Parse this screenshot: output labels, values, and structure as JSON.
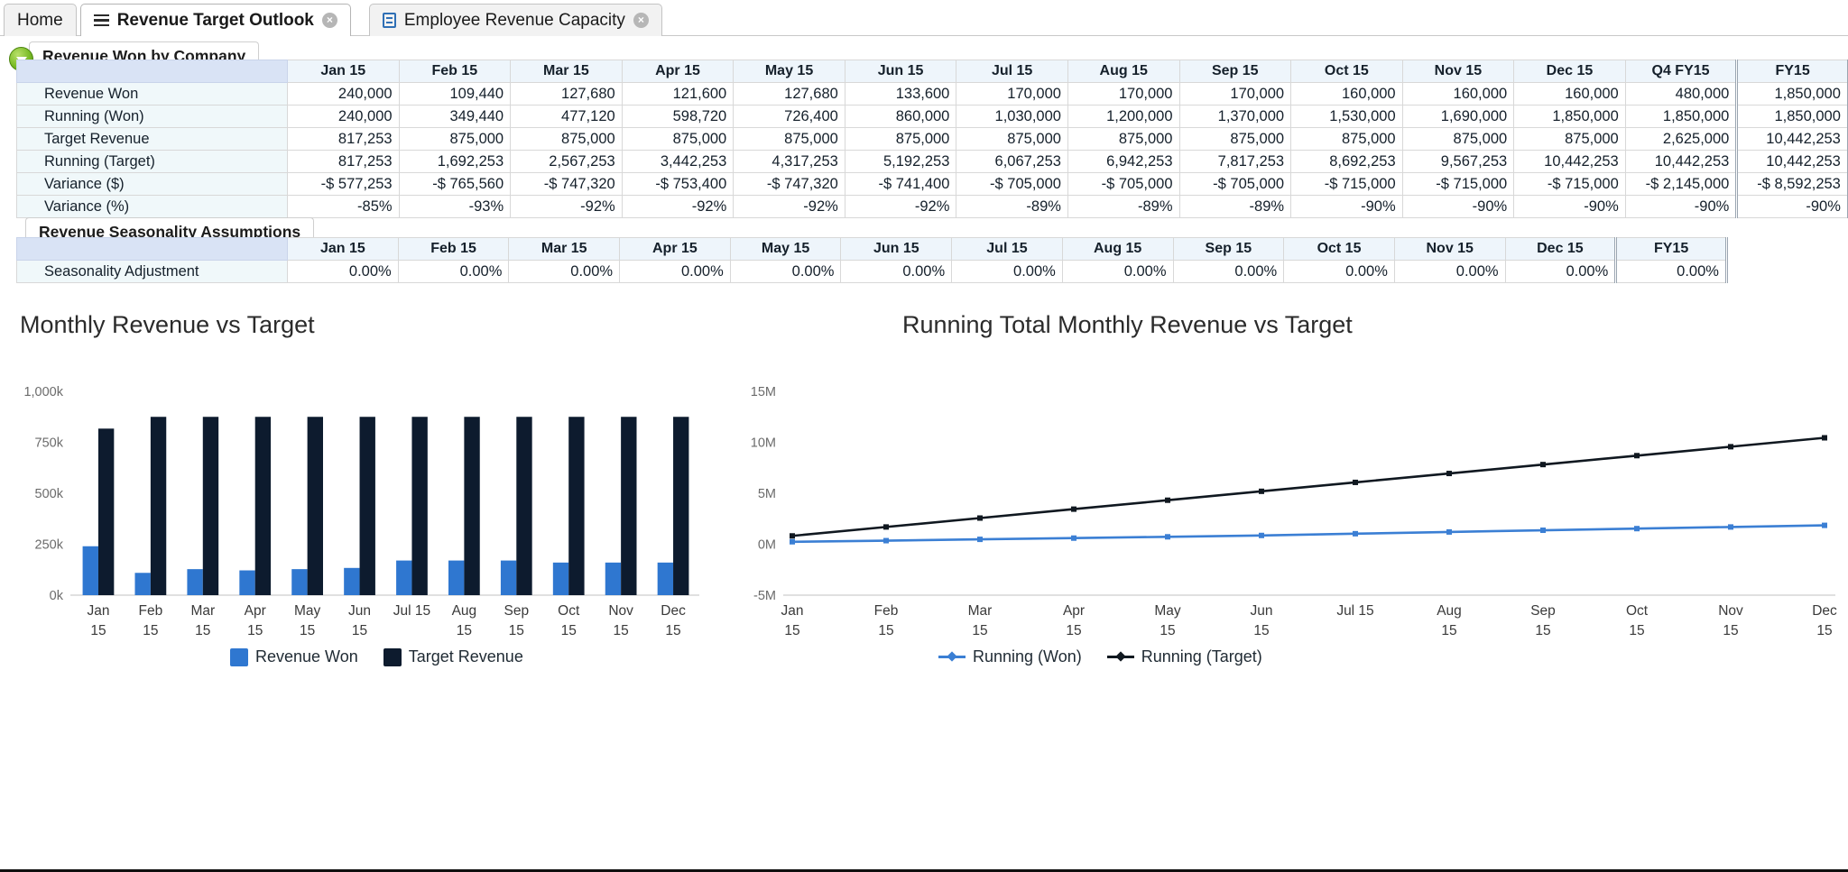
{
  "tabs": [
    {
      "label": "Home",
      "icon": null,
      "closable": false,
      "active": false
    },
    {
      "label": "Revenue Target Outlook",
      "icon": "hamburger-icon",
      "closable": true,
      "active": true
    },
    {
      "label": "Employee Revenue Capacity",
      "icon": "worksheet-icon",
      "closable": true,
      "active": false
    }
  ],
  "close_glyph": "×",
  "panel1": {
    "caption": "Revenue Won by Company",
    "collapse_icon": "chevron-down-icon",
    "columns": [
      "Jan 15",
      "Feb 15",
      "Mar 15",
      "Apr 15",
      "May 15",
      "Jun 15",
      "Jul 15",
      "Aug 15",
      "Sep 15",
      "Oct 15",
      "Nov 15",
      "Dec 15",
      "Q4 FY15",
      "FY15"
    ],
    "rows": [
      {
        "label": "Revenue Won",
        "values": [
          "240,000",
          "109,440",
          "127,680",
          "121,600",
          "127,680",
          "133,600",
          "170,000",
          "170,000",
          "170,000",
          "160,000",
          "160,000",
          "160,000",
          "480,000",
          "1,850,000"
        ]
      },
      {
        "label": "Running (Won)",
        "values": [
          "240,000",
          "349,440",
          "477,120",
          "598,720",
          "726,400",
          "860,000",
          "1,030,000",
          "1,200,000",
          "1,370,000",
          "1,530,000",
          "1,690,000",
          "1,850,000",
          "1,850,000",
          "1,850,000"
        ]
      },
      {
        "label": "Target Revenue",
        "values": [
          "817,253",
          "875,000",
          "875,000",
          "875,000",
          "875,000",
          "875,000",
          "875,000",
          "875,000",
          "875,000",
          "875,000",
          "875,000",
          "875,000",
          "2,625,000",
          "10,442,253"
        ]
      },
      {
        "label": "Running (Target)",
        "values": [
          "817,253",
          "1,692,253",
          "2,567,253",
          "3,442,253",
          "4,317,253",
          "5,192,253",
          "6,067,253",
          "6,942,253",
          "7,817,253",
          "8,692,253",
          "9,567,253",
          "10,442,253",
          "10,442,253",
          "10,442,253"
        ]
      },
      {
        "label": "Variance ($)",
        "values": [
          "-$ 577,253",
          "-$ 765,560",
          "-$ 747,320",
          "-$ 753,400",
          "-$ 747,320",
          "-$ 741,400",
          "-$ 705,000",
          "-$ 705,000",
          "-$ 705,000",
          "-$ 715,000",
          "-$ 715,000",
          "-$ 715,000",
          "-$ 2,145,000",
          "-$ 8,592,253"
        ]
      },
      {
        "label": "Variance (%)",
        "values": [
          "-85%",
          "-93%",
          "-92%",
          "-92%",
          "-92%",
          "-92%",
          "-89%",
          "-89%",
          "-89%",
          "-90%",
          "-90%",
          "-90%",
          "-90%",
          "-90%"
        ]
      }
    ]
  },
  "panel2": {
    "caption": "Revenue Seasonality Assumptions",
    "columns": [
      "Jan 15",
      "Feb 15",
      "Mar 15",
      "Apr 15",
      "May 15",
      "Jun 15",
      "Jul 15",
      "Aug 15",
      "Sep 15",
      "Oct 15",
      "Nov 15",
      "Dec 15",
      "FY15"
    ],
    "rows": [
      {
        "label": "Seasonality Adjustment",
        "values": [
          "0.00%",
          "0.00%",
          "0.00%",
          "0.00%",
          "0.00%",
          "0.00%",
          "0.00%",
          "0.00%",
          "0.00%",
          "0.00%",
          "0.00%",
          "0.00%",
          "0.00%"
        ]
      }
    ]
  },
  "colors": {
    "revenue_won": "#2f77d0",
    "target_revenue": "#0d1b2e",
    "running_won": "#3b7fd4",
    "running_target": "#101820",
    "header_blue": "#eef5fb",
    "corner_blue": "#d9e3f5",
    "rowlabel_bg": "#f0f8fa"
  },
  "chart_data": [
    {
      "type": "bar",
      "title": "Monthly Revenue vs Target",
      "categories": [
        "Jan 15",
        "Feb 15",
        "Mar 15",
        "Apr 15",
        "May 15",
        "Jun 15",
        "Jul 15",
        "Aug 15",
        "Sep 15",
        "Oct 15",
        "Nov 15",
        "Dec 15"
      ],
      "series": [
        {
          "name": "Revenue Won",
          "color": "#2f77d0",
          "values": [
            240000,
            109440,
            127680,
            121600,
            127680,
            133600,
            170000,
            170000,
            170000,
            160000,
            160000,
            160000
          ]
        },
        {
          "name": "Target Revenue",
          "color": "#0d1b2e",
          "values": [
            817253,
            875000,
            875000,
            875000,
            875000,
            875000,
            875000,
            875000,
            875000,
            875000,
            875000,
            875000
          ]
        }
      ],
      "ylim": [
        0,
        1000000
      ],
      "yticks": [
        0,
        250000,
        500000,
        750000,
        1000000
      ],
      "yticklabels": [
        "0k",
        "250k",
        "500k",
        "750k",
        "1,000k"
      ],
      "xlabel": "",
      "ylabel": "",
      "grid": false,
      "legend_position": "bottom"
    },
    {
      "type": "line",
      "title": "Running Total Monthly Revenue vs Target",
      "categories": [
        "Jan 15",
        "Feb 15",
        "Mar 15",
        "Apr 15",
        "May 15",
        "Jun 15",
        "Jul 15",
        "Aug 15",
        "Sep 15",
        "Oct 15",
        "Nov 15",
        "Dec 15"
      ],
      "series": [
        {
          "name": "Running (Won)",
          "color": "#3b7fd4",
          "values": [
            240000,
            349440,
            477120,
            598720,
            726400,
            860000,
            1030000,
            1200000,
            1370000,
            1530000,
            1690000,
            1850000
          ]
        },
        {
          "name": "Running (Target)",
          "color": "#101820",
          "values": [
            817253,
            1692253,
            2567253,
            3442253,
            4317253,
            5192253,
            6067253,
            6942253,
            7817253,
            8692253,
            9567253,
            10442253
          ]
        }
      ],
      "ylim": [
        -5000000,
        15000000
      ],
      "yticks": [
        -5000000,
        0,
        5000000,
        10000000,
        15000000
      ],
      "yticklabels": [
        "-5M",
        "0M",
        "5M",
        "10M",
        "15M"
      ],
      "xlabel": "",
      "ylabel": "",
      "grid": false,
      "legend_position": "bottom"
    }
  ]
}
